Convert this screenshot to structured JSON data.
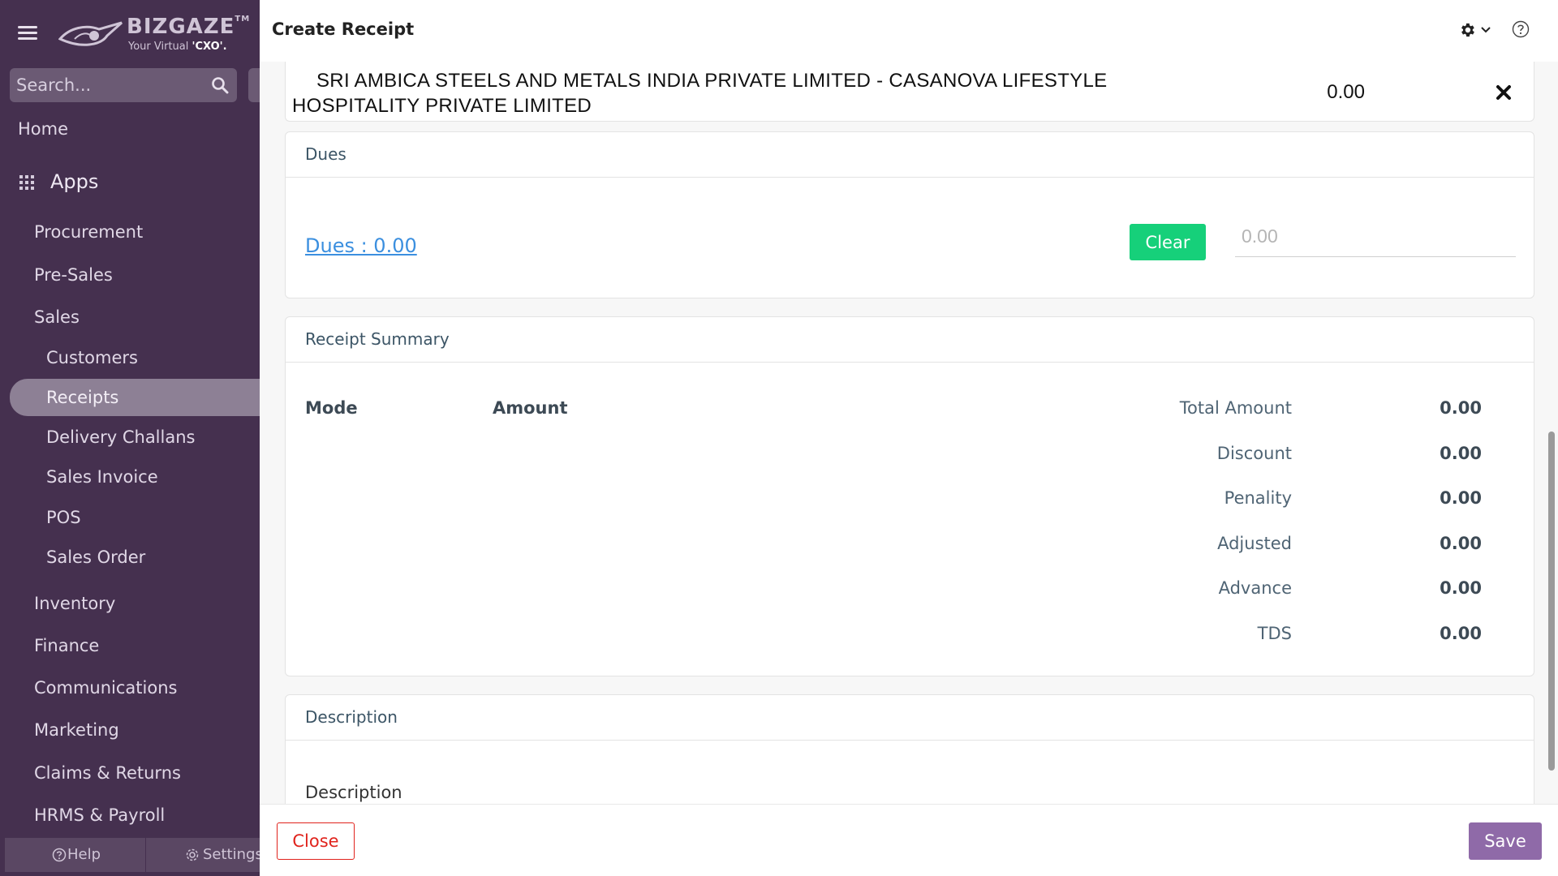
{
  "brand": {
    "name": "BIZGAZE",
    "trademark": "TM",
    "tagline_prefix": "Your Virtual",
    "tagline_bold": "'CXO'."
  },
  "sidebar": {
    "search_placeholder": "Search...",
    "home": "Home",
    "apps": "Apps",
    "items": {
      "procurement": "Procurement",
      "presales": "Pre-Sales",
      "sales": "Sales",
      "customers": "Customers",
      "receipts": "Receipts",
      "delivery_challans": "Delivery Challans",
      "sales_invoice": "Sales Invoice",
      "pos": "POS",
      "sales_order": "Sales Order",
      "inventory": "Inventory",
      "finance": "Finance",
      "communications": "Communications",
      "marketing": "Marketing",
      "claims_returns": "Claims & Returns",
      "hrms_payroll": "HRMS & Payroll"
    },
    "active_item": "Receipts",
    "help": "Help",
    "settings": "Settings"
  },
  "header": {
    "title": "Create Receipt"
  },
  "party": {
    "name": "SRI AMBICA STEELS AND METALS INDIA PRIVATE LIMITED - CASANOVA LIFESTYLE HOSPITALITY PRIVATE LIMITED",
    "amount": "0.00"
  },
  "dues": {
    "title": "Dues",
    "link": "Dues : 0.00",
    "clear_label": "Clear",
    "amount_placeholder": "0.00"
  },
  "summary": {
    "title": "Receipt Summary",
    "col_mode": "Mode",
    "col_amount": "Amount",
    "rows": [
      {
        "label": "Total Amount",
        "value": "0.00"
      },
      {
        "label": "Discount",
        "value": "0.00"
      },
      {
        "label": "Penality",
        "value": "0.00"
      },
      {
        "label": "Adjusted",
        "value": "0.00"
      },
      {
        "label": "Advance",
        "value": "0.00"
      },
      {
        "label": "TDS",
        "value": "0.00"
      }
    ]
  },
  "description": {
    "title": "Description",
    "field_label": "Description"
  },
  "footer": {
    "close_label": "Close",
    "save_label": "Save"
  },
  "colors": {
    "sidebar_bg": "#45304f",
    "active_item_bg": "#8d8095",
    "clear_button": "#16d07a",
    "save_button": "#8f6aa8",
    "close_button": "#e0231c",
    "dues_link": "#3b8fdf"
  },
  "icons": [
    "menu-icon",
    "logo-icon",
    "search-icon",
    "apps-grid-icon",
    "help-icon",
    "settings-icon",
    "gear-icon",
    "chevron-down-icon",
    "question-circle-icon",
    "close-icon"
  ]
}
